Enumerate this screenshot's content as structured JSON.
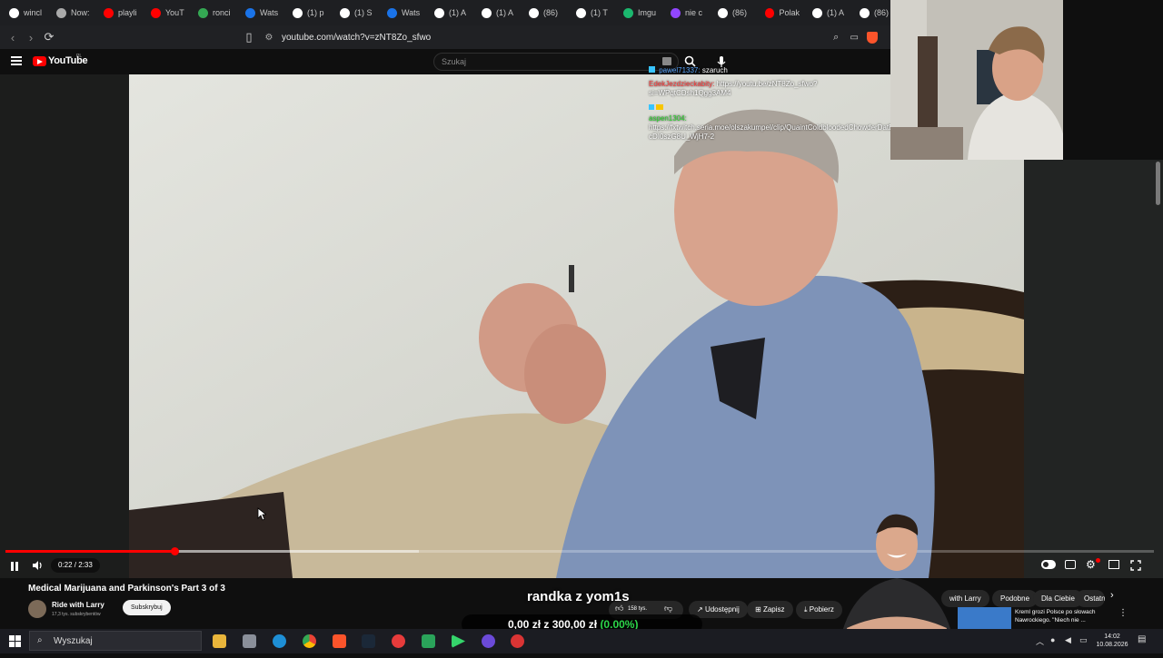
{
  "browser": {
    "tabs": [
      {
        "label": "wincl",
        "icon": "google-icon",
        "color": "#ffffff"
      },
      {
        "label": "Now:",
        "icon": "shield-icon",
        "color": "#aaaaaa"
      },
      {
        "label": "playli",
        "icon": "youtube-icon",
        "color": "#ff0000"
      },
      {
        "label": "YouT",
        "icon": "youtube-icon",
        "color": "#ff0000"
      },
      {
        "label": "ronci",
        "icon": "maps-pin-icon",
        "color": "#34a853"
      },
      {
        "label": "Wats",
        "icon": "whatsapp-icon",
        "color": "#1a73e8"
      },
      {
        "label": "(1) p",
        "icon": "x-icon",
        "color": "#ffffff"
      },
      {
        "label": "(1) S",
        "icon": "x-icon",
        "color": "#ffffff"
      },
      {
        "label": "Wats",
        "icon": "whatsapp-icon",
        "color": "#1a73e8"
      },
      {
        "label": "(1) A",
        "icon": "x-icon",
        "color": "#ffffff"
      },
      {
        "label": "(1) A",
        "icon": "x-icon",
        "color": "#ffffff"
      },
      {
        "label": "(86)",
        "icon": "tiktok-icon",
        "color": "#ffffff"
      },
      {
        "label": "(1) T",
        "icon": "x-icon",
        "color": "#ffffff"
      },
      {
        "label": "Imgu",
        "icon": "imgur-icon",
        "color": "#1bb76e"
      },
      {
        "label": "nie c",
        "icon": "twitch-icon",
        "color": "#9146ff"
      },
      {
        "label": "(86)",
        "icon": "tiktok-icon",
        "color": "#ffffff"
      },
      {
        "label": "Polak",
        "icon": "youtube-icon",
        "color": "#ff0000"
      },
      {
        "label": "(1) A",
        "icon": "x-icon",
        "color": "#ffffff"
      },
      {
        "label": "(86)",
        "icon": "tiktok-icon",
        "color": "#ffffff"
      }
    ],
    "url": "youtube.com/watch?v=zNT8Zo_sfwo"
  },
  "youtube": {
    "logo_text": "YouTube",
    "region": "PL",
    "search_placeholder": "Szukaj",
    "accent": "#ff0000"
  },
  "chat": [
    {
      "user": "pawel71337:",
      "text": "szaruch",
      "color": "#5aa7ff"
    },
    {
      "user": "EdekJezdzieckabity:",
      "text": "https://youtu.be/zNT8Zo_sfwo?si=WPqtCDsh1Qgg3AM4",
      "color": "#ff3b3b"
    },
    {
      "user": "aspen1304:",
      "text": "https://fxtwitch.seria.moe/olszakumpel/clip/QuaintColdbloodedChowderDatBoi-cDI0szG8U_WjH7-2",
      "color": "#29d62b"
    }
  ],
  "player": {
    "time": "0:22 / 2:33",
    "progress_fraction": 0.147,
    "buffer_fraction": 0.36
  },
  "video": {
    "title": "Medical Marijuana and Parkinson's Part 3 of 3",
    "channel": "Ride with Larry",
    "subscribers": "17,3 tys. subskrybentów",
    "subscribe_label": "Subskrybuj",
    "likes": "158 tys.",
    "share_label": "Udostępnij",
    "save_label": "Zapisz",
    "download_label": "Pobierz"
  },
  "overlay": {
    "stream_title": "randka z yom1s",
    "donation_current": "0,00 zł",
    "donation_sep": "z",
    "donation_goal": "300,00 zł",
    "donation_percent": "(0.00%)"
  },
  "sidebar": {
    "chips": [
      "with Larry",
      "Podobne",
      "Dla Ciebie",
      "Ostatni"
    ],
    "rec_title": "Kreml grozi Polsce po słowach Nawrockiego. \"Niech nie ..."
  },
  "taskbar": {
    "search_placeholder": "Wyszukaj",
    "time": "14:02",
    "date": "10.08.2026"
  }
}
